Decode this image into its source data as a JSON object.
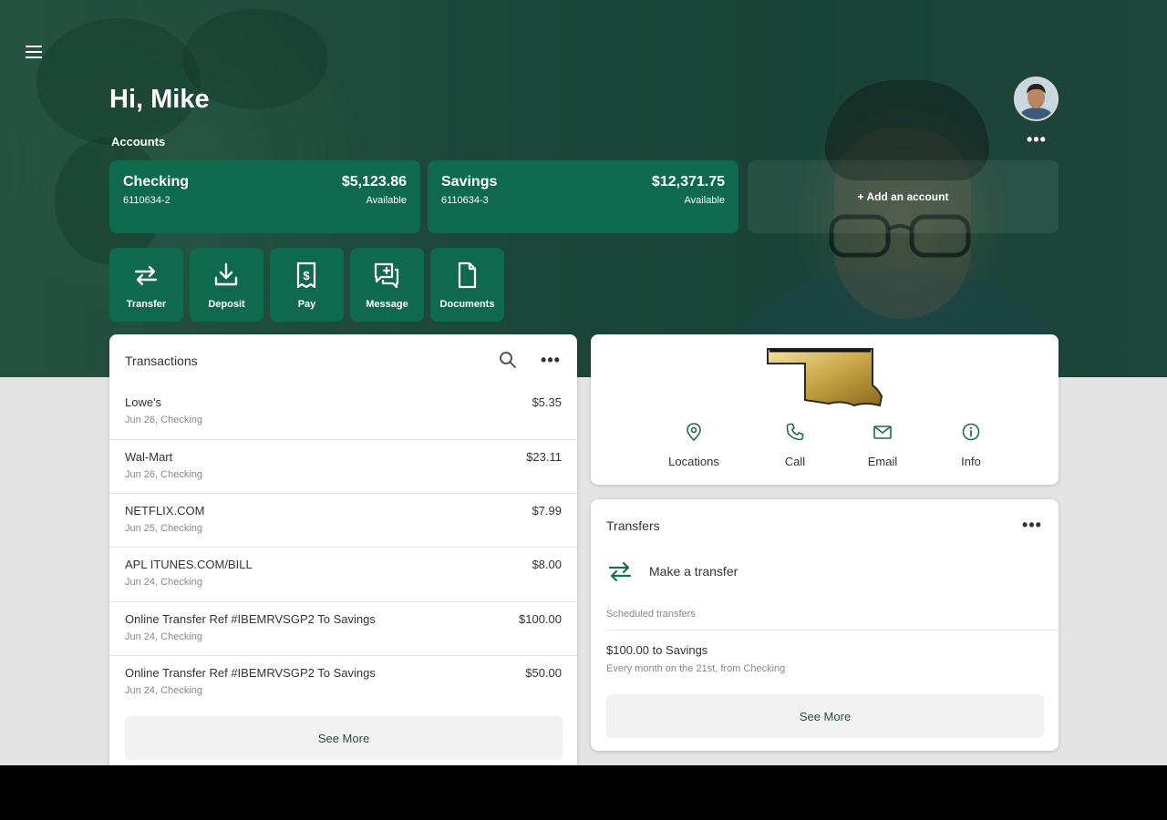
{
  "header": {
    "greeting": "Hi, Mike",
    "accounts_label": "Accounts",
    "add_account_label": "+ Add an account"
  },
  "accounts": [
    {
      "name": "Checking",
      "number": "6110634-2",
      "balance": "$5,123.86",
      "balance_label": "Available"
    },
    {
      "name": "Savings",
      "number": "6110634-3",
      "balance": "$12,371.75",
      "balance_label": "Available"
    }
  ],
  "actions": [
    {
      "label": "Transfer",
      "icon": "transfer-icon"
    },
    {
      "label": "Deposit",
      "icon": "deposit-icon"
    },
    {
      "label": "Pay",
      "icon": "pay-icon"
    },
    {
      "label": "Message",
      "icon": "message-icon"
    },
    {
      "label": "Documents",
      "icon": "documents-icon"
    }
  ],
  "transactions": {
    "title": "Transactions",
    "items": [
      {
        "description": "Lowe's",
        "meta": "Jun 26, Checking",
        "amount": "$5.35"
      },
      {
        "description": "Wal-Mart",
        "meta": "Jun 26, Checking",
        "amount": "$23.11"
      },
      {
        "description": "NETFLIX.COM",
        "meta": "Jun 25, Checking",
        "amount": "$7.99"
      },
      {
        "description": "APL ITUNES.COM/BILL",
        "meta": "Jun 24, Checking",
        "amount": "$8.00"
      },
      {
        "description": "Online Transfer Ref #IBEMRVSGP2 To Savings",
        "meta": "Jun 24, Checking",
        "amount": "$100.00"
      },
      {
        "description": "Online Transfer Ref #IBEMRVSGP2 To Savings",
        "meta": "Jun 24, Checking",
        "amount": "$50.00"
      }
    ],
    "see_more": "See More"
  },
  "bank_info": {
    "items": [
      {
        "label": "Locations",
        "icon": "location-pin-icon"
      },
      {
        "label": "Call",
        "icon": "phone-icon"
      },
      {
        "label": "Email",
        "icon": "envelope-icon"
      },
      {
        "label": "Info",
        "icon": "info-icon"
      }
    ]
  },
  "transfers": {
    "title": "Transfers",
    "make_transfer": "Make a transfer",
    "scheduled_label": "Scheduled transfers",
    "scheduled": [
      {
        "title": "$100.00 to Savings",
        "detail": "Every month on the 21st, from Checking"
      }
    ],
    "see_more": "See More"
  },
  "colors": {
    "brand_green": "#0f6a4d",
    "hero_bg": "#234a3d",
    "page_bg": "#e4e4e4",
    "card_bg": "#ffffff"
  }
}
